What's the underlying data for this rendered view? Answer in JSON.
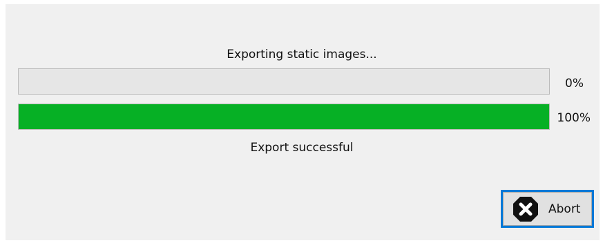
{
  "dialog": {
    "status_top": "Exporting static images...",
    "status_bottom": "Export successful",
    "progress_bars": [
      {
        "label": "0%",
        "fraction": 0.0,
        "color": "#06b025"
      },
      {
        "label": "100%",
        "fraction": 1.0,
        "color": "#06b025"
      }
    ],
    "abort_button": {
      "label": "Abort",
      "icon": "abort-stop-icon",
      "focus_color": "#0078d7"
    }
  }
}
